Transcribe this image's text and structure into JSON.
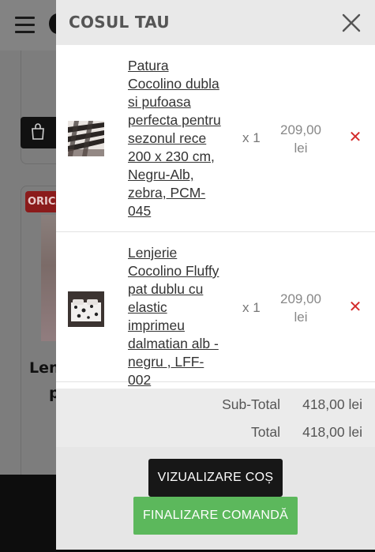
{
  "background": {
    "badge_text": "ORICA",
    "product_title_line1": "Lenj",
    "product_title_line2": "p"
  },
  "cart": {
    "title": "COSUL TAU",
    "items": [
      {
        "name": "Patura Cocolino dubla si pufoasa perfecta pentru sezonul rece 200 x 230 cm, Negru-Alb, zebra, PCM-045",
        "qty": "x 1",
        "price": "209,00 lei",
        "thumb": "zebra-blanket-thumbnail"
      },
      {
        "name": "Lenjerie Cocolino Fluffy pat dublu cu elastic imprimeu dalmatian alb - negru , LFF-002",
        "qty": "x 1",
        "price": "209,00 lei",
        "thumb": "dalmatian-bedding-thumbnail"
      }
    ],
    "subtotal_label": "Sub-Total",
    "subtotal_value": "418,00 lei",
    "total_label": "Total",
    "total_value": "418,00 lei",
    "view_cart_label": "VIZUALIZARE COȘ",
    "checkout_label": "FINALIZARE COMANDĂ"
  },
  "icons": {
    "menu": "hamburger-menu-icon",
    "close": "close-icon",
    "remove": "remove-x-icon",
    "cart": "shopping-bag-icon"
  },
  "colors": {
    "remove": "#d42b2b",
    "checkout": "#5cb85c",
    "view_cart": "#171717"
  }
}
